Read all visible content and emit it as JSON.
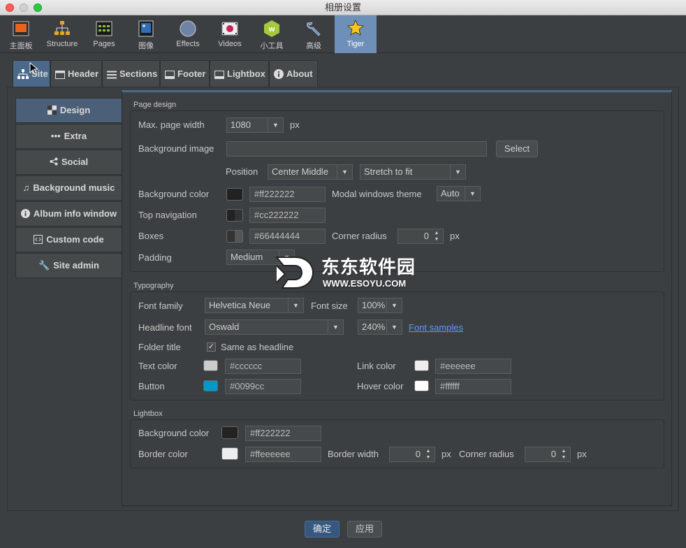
{
  "window": {
    "title": "相册设置"
  },
  "toolbar": {
    "items": [
      {
        "label": "主面板",
        "icon": "dashboard-icon"
      },
      {
        "label": "Structure",
        "icon": "structure-icon"
      },
      {
        "label": "Pages",
        "icon": "pages-icon"
      },
      {
        "label": "图像",
        "icon": "image-icon"
      },
      {
        "label": "Effects",
        "icon": "effects-icon"
      },
      {
        "label": "Videos",
        "icon": "videos-icon"
      },
      {
        "label": "小工具",
        "icon": "widget-icon"
      },
      {
        "label": "高级",
        "icon": "wrench-icon"
      },
      {
        "label": "Tiger",
        "icon": "tiger-icon"
      }
    ],
    "active": "Tiger"
  },
  "tabs": [
    "Site",
    "Header",
    "Sections",
    "Footer",
    "Lightbox",
    "About"
  ],
  "side": [
    "Design",
    "Extra",
    "Social",
    "Background music",
    "Album info window",
    "Custom code",
    "Site admin"
  ],
  "page_design": {
    "title": "Page design",
    "max_width_label": "Max. page width",
    "max_width_value": "1080",
    "max_width_unit": "px",
    "bg_image_label": "Background image",
    "bg_image_value": "",
    "select_label": "Select",
    "position_label": "Position",
    "position_value": "Center Middle",
    "stretch_value": "Stretch to fit",
    "bg_color_label": "Background color",
    "bg_color_value": "#ff222222",
    "modal_label": "Modal windows theme",
    "modal_value": "Auto",
    "topnav_label": "Top navigation",
    "topnav_value": "#cc222222",
    "boxes_label": "Boxes",
    "boxes_value": "#66444444",
    "corner_label": "Corner radius",
    "corner_value": "0",
    "corner_unit": "px",
    "padding_label": "Padding",
    "padding_value": "Medium"
  },
  "typography": {
    "title": "Typography",
    "font_family_label": "Font family",
    "font_family_value": "Helvetica Neue",
    "font_size_label": "Font size",
    "font_size_value": "100%",
    "headline_label": "Headline font",
    "headline_value": "Oswald",
    "headline_size": "240%",
    "samples_link": "Font samples",
    "folder_label": "Folder title",
    "same_label": "Same as headline",
    "same_checked": "✓",
    "text_color_label": "Text color",
    "text_color_value": "#cccccc",
    "link_color_label": "Link color",
    "link_color_value": "#eeeeee",
    "button_label": "Button",
    "button_value": "#0099cc",
    "hover_label": "Hover color",
    "hover_value": "#ffffff"
  },
  "lightbox": {
    "title": "Lightbox",
    "bg_label": "Background color",
    "bg_value": "#ff222222",
    "border_label": "Border color",
    "border_value": "#ffeeeeee",
    "border_width_label": "Border width",
    "border_width_value": "0",
    "border_width_unit": "px",
    "corner_label": "Corner radius",
    "corner_value": "0",
    "corner_unit": "px"
  },
  "watermark": {
    "text": "东东软件园",
    "url": "WWW.ESOYU.COM"
  },
  "footer": {
    "ok": "确定",
    "apply": "应用"
  },
  "colors": {
    "swatch_dark": "#222222",
    "swatch_light": "#cccccc",
    "swatch_link": "#eeeeee",
    "swatch_button": "#0099cc",
    "swatch_white": "#ffffff"
  }
}
